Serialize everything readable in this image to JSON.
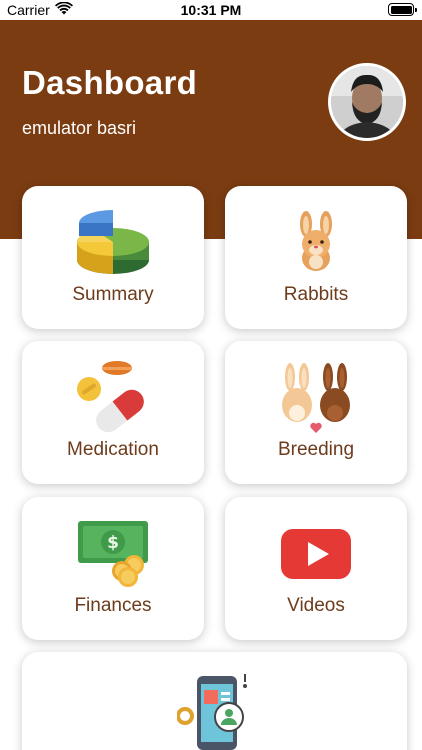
{
  "status_bar": {
    "carrier": "Carrier",
    "time": "10:31 PM"
  },
  "header": {
    "title": "Dashboard",
    "subtitle": "emulator basri"
  },
  "menu": [
    {
      "label": "Summary",
      "icon": "pie-chart-icon"
    },
    {
      "label": "Rabbits",
      "icon": "rabbit-icon"
    },
    {
      "label": "Medication",
      "icon": "pills-icon"
    },
    {
      "label": "Breeding",
      "icon": "rabbit-couple-icon"
    },
    {
      "label": "Finances",
      "icon": "money-icon"
    },
    {
      "label": "Videos",
      "icon": "video-play-icon"
    },
    {
      "label": "",
      "icon": "mobile-profile-icon"
    }
  ],
  "colors": {
    "header_bg": "#7b3c12",
    "label_color": "#6e3b1c",
    "card_bg": "#ffffff"
  }
}
